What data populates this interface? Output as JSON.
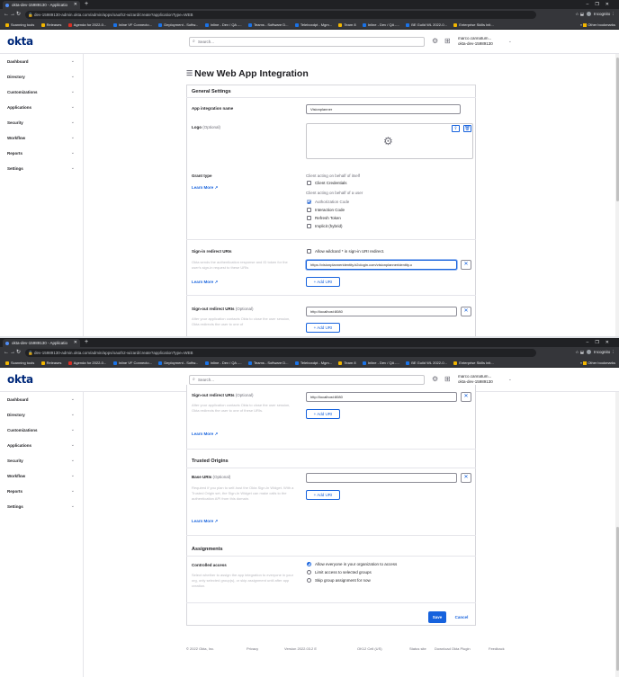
{
  "browser": {
    "tab_title": "okta-dev-15989130 - Applicatio",
    "url": "dev-15989130-admin.okta.com/admin/apps/oauth2-wizard/create?applicationType=WEB",
    "incognito_label": "Incognito",
    "bookmarks": [
      "Scanning tools",
      "Releases",
      "Agenda for 2022-0...",
      "Inline VF Connecto...",
      "Deployment - Softw...",
      "Inline - Dev / QA -...",
      "Teams - Software D...",
      "Teleboxdpt - Mgm...",
      "Team 8",
      "Inline - Dev / QA -...",
      "BE Guild WL 2022-0...",
      "Enterprise Skills Init..."
    ],
    "other_bookmarks": "Other bookmarks"
  },
  "header": {
    "logo": "okta",
    "search_placeholder": "Search...",
    "user_line1": "marco.cannatum...",
    "user_line2": "okta-dev-15989130"
  },
  "sidebar": {
    "items": [
      "Dashboard",
      "Directory",
      "Customizations",
      "Applications",
      "Security",
      "Workflow",
      "Reports",
      "Settings"
    ]
  },
  "page": {
    "title": "New Web App Integration",
    "general_settings": "General Settings",
    "app_name_label": "App integration name",
    "app_name_value": "Visionplanner",
    "logo_label": "Logo",
    "optional": "(Optional)",
    "grant_type_label": "Grant type",
    "learn_more": "Learn More",
    "client_self": "Client acting on behalf of itself",
    "client_credentials": "Client Credentials",
    "client_user": "Client acting on behalf of a user",
    "grants": [
      {
        "label": "Authorization Code",
        "checked": true
      },
      {
        "label": "Interaction Code",
        "checked": false
      },
      {
        "label": "Refresh Token",
        "checked": false
      },
      {
        "label": "Implicit (hybrid)",
        "checked": false
      }
    ],
    "signin_label": "Sign-in redirect URIs",
    "signin_help": "Okta sends the authentication response and ID token for the user's sign-in request to these URIs",
    "wildcard_label": "Allow wildcard * in sign-in URI redirect.",
    "signin_value": "https://visionplanneridentity.b2clogin.com/visionplanneridentity.o",
    "add_uri": "+ Add URI",
    "signout_label": "Sign-out redirect URIs",
    "signout_help_a": "After your application contacts Okta to close the user session, Okta redirects the user to one of",
    "signout_help_b": "After your application contacts Okta to close the user session, Okta redirects the user to one of these URIs.",
    "signout_value": "http://localhost:8080",
    "trusted_origins": "Trusted Origins",
    "base_uris_label": "Base URIs",
    "base_uris_help": "Required if you plan to self-host the Okta Sign-In Widget. With a Trusted Origin set, the Sign-In Widget can make calls to the authentication API from this domain.",
    "assignments": "Assignments",
    "controlled_access": "Controlled access",
    "controlled_help": "Select whether to assign the app integration to everyone in your org, only selected group(s), or skip assignment until after app creation.",
    "access_options": [
      {
        "label": "Allow everyone in your organization to access",
        "selected": true
      },
      {
        "label": "Limit access to selected groups",
        "selected": false
      },
      {
        "label": "Skip group assignment for now",
        "selected": false
      }
    ],
    "save": "Save",
    "cancel": "Cancel"
  },
  "footer": {
    "copyright": "© 2022 Okta, Inc.",
    "privacy": "Privacy",
    "version": "Version 2022.03.2 E",
    "cell": "OK12 Cell (US)",
    "status": "Status site",
    "plugin": "Download Okta Plugin",
    "feedback": "Feedback"
  }
}
